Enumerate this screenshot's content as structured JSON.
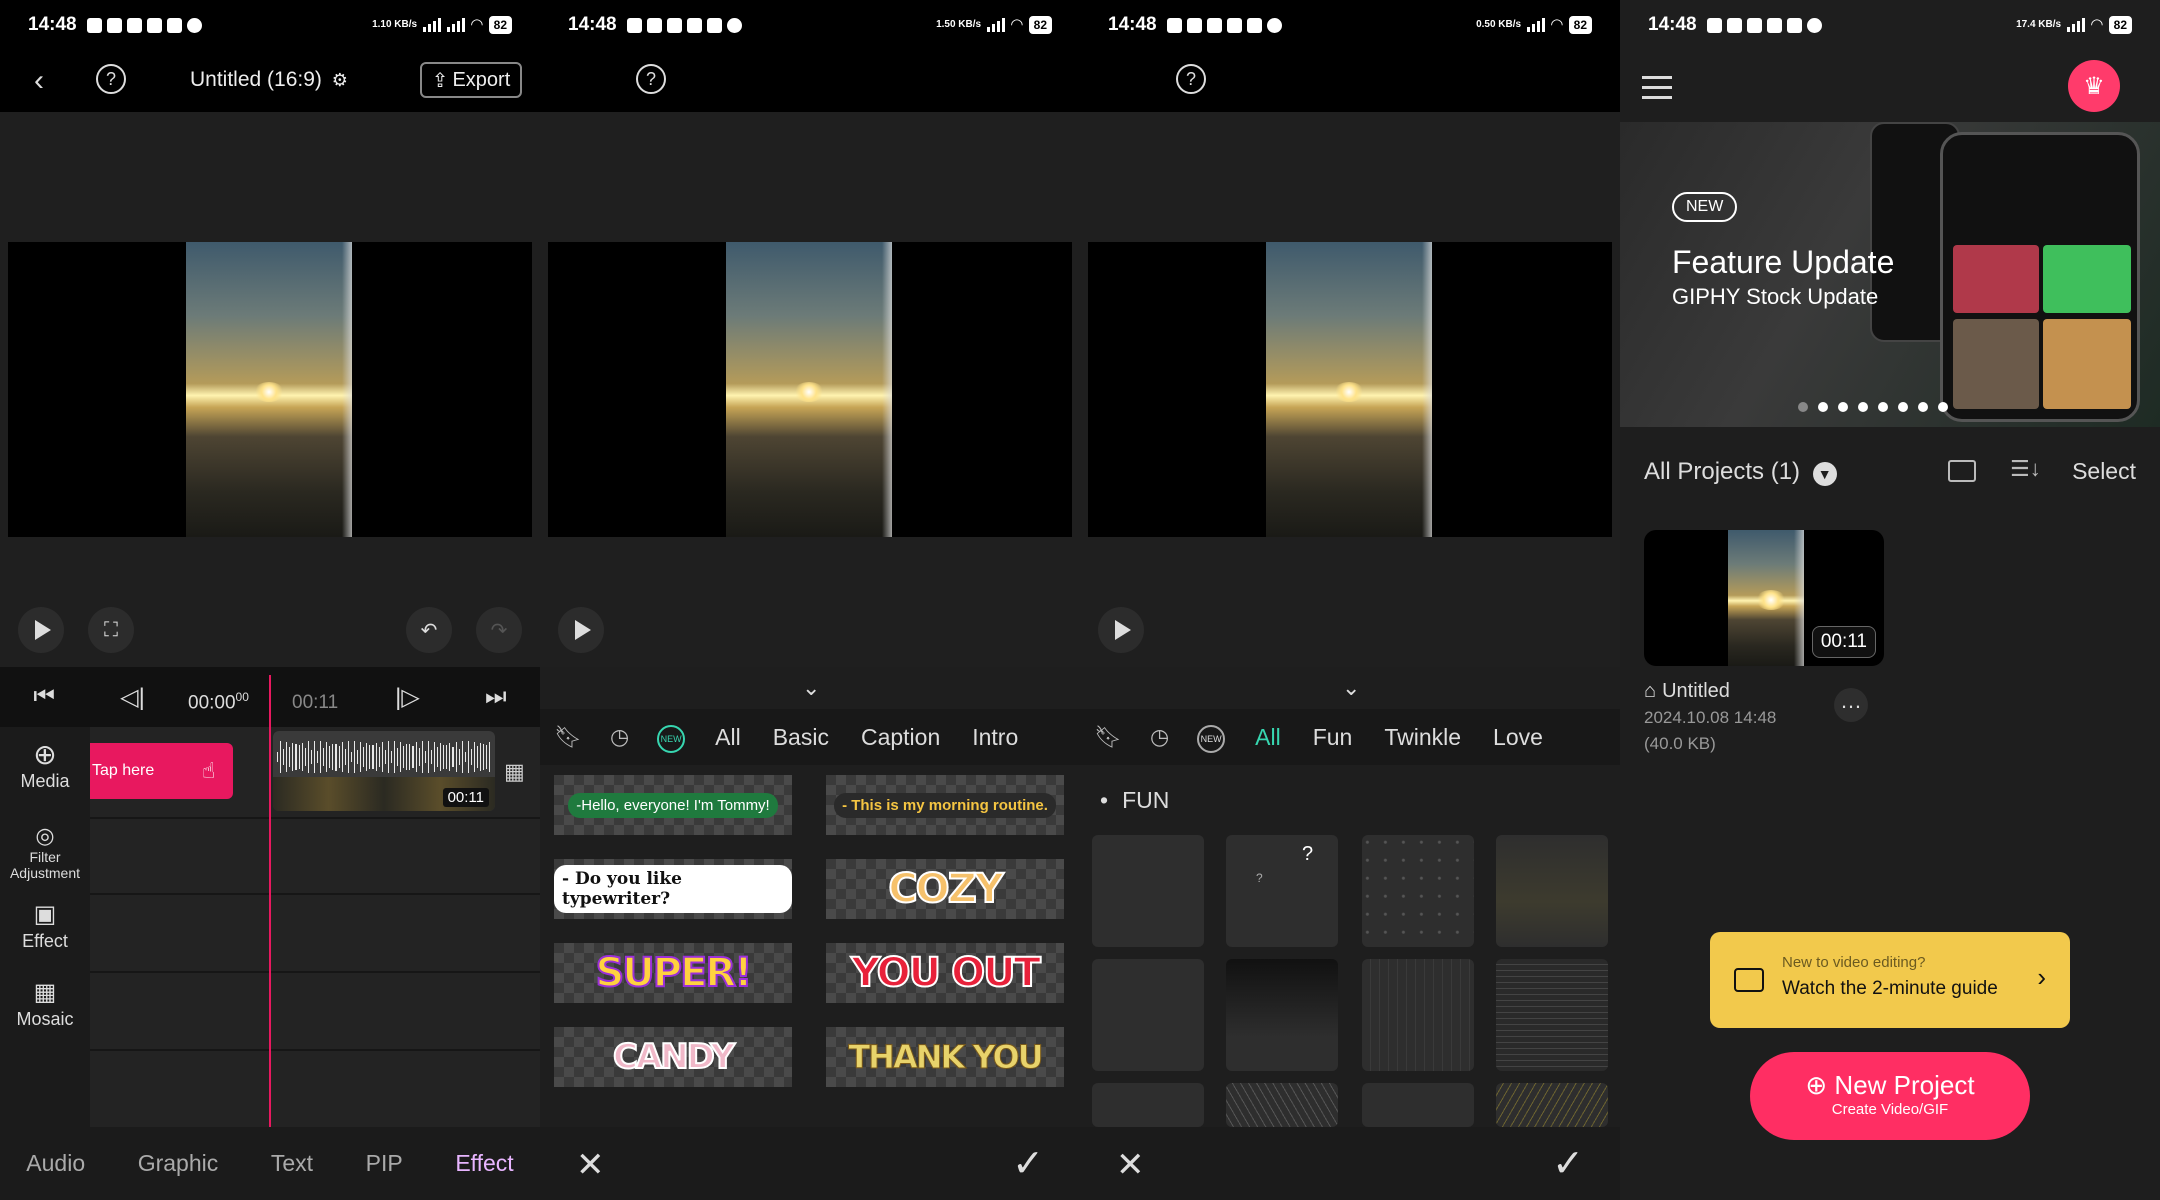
{
  "status": {
    "time": "14:48",
    "speeds": [
      "1.10 KB/s",
      "1.50 KB/s",
      "0.50 KB/s",
      "17.4 KB/s"
    ],
    "battery": "82"
  },
  "editor": {
    "title": "Untitled (16:9)",
    "export_label": "Export",
    "timecode_current": "00:00",
    "timecode_frames": "00",
    "timecode_end": "00:11",
    "tap_here": "Tap here",
    "clip_duration": "00:11",
    "sidebar": [
      {
        "icon": "media-icon",
        "label": "Media"
      },
      {
        "icon": "filter-icon",
        "label": "Filter Adjustment"
      },
      {
        "icon": "effect-icon",
        "label": "Effect"
      },
      {
        "icon": "mosaic-icon",
        "label": "Mosaic"
      }
    ],
    "tabs": [
      "Audio",
      "Graphic",
      "Text",
      "PIP",
      "Effect"
    ],
    "active_tab": "Effect"
  },
  "text_panel": {
    "categories": [
      "All",
      "Basic",
      "Caption",
      "Intro"
    ],
    "new_badge": "NEW",
    "items": [
      "-Hello, everyone! I'm Tommy!",
      "- This is my morning routine.",
      "- Do you like typewriter?",
      "COZY",
      "SUPER!",
      "YOU OUT",
      "CANDY",
      "THANK YOU"
    ]
  },
  "effect_panel": {
    "categories": [
      "All",
      "Fun",
      "Twinkle",
      "Love"
    ],
    "active_category": "All",
    "new_badge": "NEW",
    "section": "FUN"
  },
  "home": {
    "banner_badge": "NEW",
    "banner_title": "Feature Update",
    "banner_subtitle": "GIPHY Stock Update",
    "projects_label": "All Projects (1)",
    "select_label": "Select",
    "project": {
      "name": "Untitled",
      "date": "2024.10.08 14:48",
      "size": "(40.0 KB)",
      "duration": "00:11"
    },
    "guide_line1": "New to video editing?",
    "guide_line2": "Watch the 2-minute guide",
    "new_project": "New Project",
    "new_project_sub": "Create Video/GIF"
  },
  "colors": {
    "accent_pink": "#e8185f",
    "accent_green": "#37d6b0",
    "accent_purple": "#e8b5ff",
    "guide_yellow": "#f2c94c"
  }
}
